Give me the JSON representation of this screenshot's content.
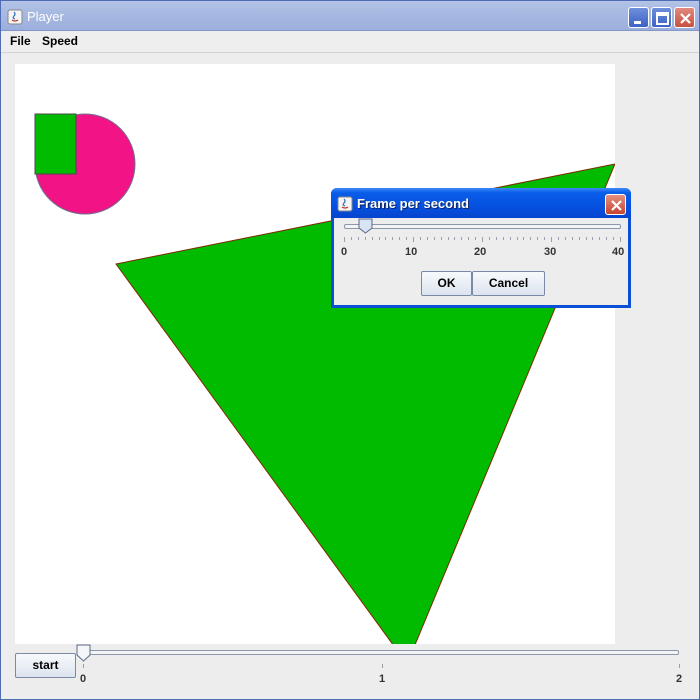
{
  "window": {
    "title": "Player",
    "controls": [
      "minimize-icon",
      "maximize-icon",
      "close-icon"
    ],
    "title_gradient": [
      "#b4c3e6",
      "#9cafdc"
    ]
  },
  "menubar": {
    "items": [
      {
        "label": "File"
      },
      {
        "label": "Speed"
      }
    ]
  },
  "canvas": {
    "background": "#ffffff",
    "shapes": [
      {
        "kind": "circle",
        "fill": "#f21387",
        "stroke": "#6f6f8f"
      },
      {
        "kind": "rectangle",
        "fill": "#00bb00",
        "stroke": "#4a4a4a"
      },
      {
        "kind": "triangle",
        "fill": "#00bb00",
        "stroke": "#7a2a00"
      }
    ]
  },
  "controls": {
    "start_label": "start",
    "time_slider": {
      "min": 0,
      "max": 2,
      "value": 0,
      "labels": [
        "0",
        "1",
        "2"
      ]
    }
  },
  "dialog": {
    "title": "Frame per second",
    "fps_slider": {
      "min": 0,
      "max": 40,
      "value": 3,
      "labels": [
        "0",
        "10",
        "20",
        "30",
        "40"
      ]
    },
    "ok_label": "OK",
    "cancel_label": "Cancel",
    "accent": "#0a4fd6"
  }
}
